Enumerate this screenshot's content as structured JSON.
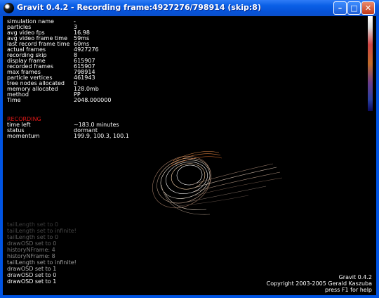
{
  "window": {
    "title": "Gravit 0.4.2 - Recording frame:4927276/798914 (skip:8)",
    "buttons": {
      "minimize": "–",
      "maximize": "□",
      "close": "✕"
    }
  },
  "stats": [
    {
      "key": "simulation name",
      "value": "-"
    },
    {
      "key": "particles",
      "value": "3"
    },
    {
      "key": "avg video fps",
      "value": "16.98"
    },
    {
      "key": "avg video frame time",
      "value": "59ms"
    },
    {
      "key": "last record frame time",
      "value": "60ms"
    },
    {
      "key": "actual frames",
      "value": "4927276"
    },
    {
      "key": "recording skip",
      "value": "8"
    },
    {
      "key": "display frame",
      "value": "615907"
    },
    {
      "key": "recorded frames",
      "value": "615907"
    },
    {
      "key": "max frames",
      "value": "798914"
    },
    {
      "key": "particle vertices",
      "value": "461943"
    },
    {
      "key": "tree nodes allocated",
      "value": "0"
    },
    {
      "key": "memory allocated",
      "value": "128.0mb"
    },
    {
      "key": "method",
      "value": " PP"
    },
    {
      "key": "Time",
      "value": "2048.000000"
    }
  ],
  "recording": {
    "heading": "RECORDING",
    "rows": [
      {
        "key": "time left",
        "value": "~183.0 minutes"
      },
      {
        "key": "status",
        "value": "dormant"
      },
      {
        "key": "momentum",
        "value": " 199.9, 100.3, 100.1"
      }
    ]
  },
  "log": [
    {
      "text": "tailLength set to 0",
      "color": "#3a3a3a"
    },
    {
      "text": "tailLength set to infinite!",
      "color": "#444444"
    },
    {
      "text": "tailLength set to 0",
      "color": "#555555"
    },
    {
      "text": "drawOSD set to 0",
      "color": "#666666"
    },
    {
      "text": "historyNFrame: 4",
      "color": "#777777"
    },
    {
      "text": "historyNFrame: 8",
      "color": "#8a8a8a"
    },
    {
      "text": "tailLength set to infinite!",
      "color": "#a0a0a0"
    },
    {
      "text": "drawOSD set to 1",
      "color": "#c0c0c0"
    },
    {
      "text": "drawOSD set to 0",
      "color": "#e0e0e0"
    },
    {
      "text": "drawOSD set to 1",
      "color": "#ffffff"
    }
  ],
  "info": {
    "version": "Gravit 0.4.2",
    "copyright": "Copyright 2003-2005 Gerald Kaszuba",
    "help": "press F1 for help"
  },
  "colors": {
    "titlebar": "#0a5fe6",
    "accent_red": "#e01818",
    "background": "#000000"
  }
}
